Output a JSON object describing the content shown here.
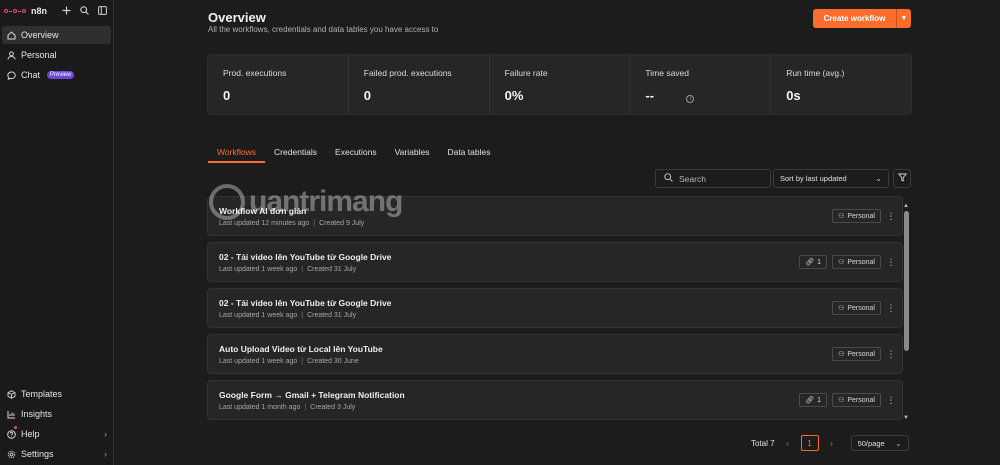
{
  "app": {
    "logo_text": "n8n",
    "brand_color": "#ea4b71",
    "accent_color": "#ff6d2d"
  },
  "sidebar": {
    "top_icons": [
      "plus-icon",
      "search-icon",
      "panel-toggle-icon"
    ],
    "items": [
      {
        "label": "Overview",
        "icon": "home-icon",
        "active": true
      },
      {
        "label": "Personal",
        "icon": "user-icon",
        "active": false
      },
      {
        "label": "Chat",
        "icon": "chat-icon",
        "active": false,
        "badge": "Preview"
      }
    ],
    "bottom_items": [
      {
        "label": "Templates",
        "icon": "box-icon"
      },
      {
        "label": "Insights",
        "icon": "chart-icon"
      },
      {
        "label": "Help",
        "icon": "help-icon"
      },
      {
        "label": "Settings",
        "icon": "gear-icon"
      }
    ]
  },
  "header": {
    "title": "Overview",
    "subtitle": "All the workflows, credentials and data tables you have access to",
    "create_label": "Create workflow"
  },
  "stats": [
    {
      "label": "Prod. executions",
      "value": "0"
    },
    {
      "label": "Failed prod. executions",
      "value": "0"
    },
    {
      "label": "Failure rate",
      "value": "0%"
    },
    {
      "label": "Time saved",
      "value": "--"
    },
    {
      "label": "Run time (avg.)",
      "value": "0s"
    }
  ],
  "tabs": [
    "Workflows",
    "Credentials",
    "Executions",
    "Variables",
    "Data tables"
  ],
  "toolbar": {
    "search_placeholder": "Search",
    "sort_label": "Sort by last updated"
  },
  "workflows": [
    {
      "name": "Workflow AI đơn giản",
      "updated": "Last updated 12 minutes ago",
      "created": "Created 9 July",
      "shared": "",
      "owner": "Personal"
    },
    {
      "name": "02 - Tải video lên YouTube từ Google Drive",
      "updated": "Last updated 1 week ago",
      "created": "Created 31 July",
      "shared": "1",
      "owner": "Personal"
    },
    {
      "name": "02 - Tải video lên YouTube từ Google Drive",
      "updated": "Last updated 1 week ago",
      "created": "Created 31 July",
      "shared": "",
      "owner": "Personal"
    },
    {
      "name": "Auto Upload Video từ Local lên YouTube",
      "updated": "Last updated 1 week ago",
      "created": "Created 30 June",
      "shared": "",
      "owner": "Personal"
    },
    {
      "name": "Google Form → Gmail + Telegram Notification",
      "updated": "Last updated 1 month ago",
      "created": "Created 3 July",
      "shared": "1",
      "owner": "Personal"
    }
  ],
  "pagination": {
    "total": "Total 7",
    "page": "1",
    "per_page": "50/page"
  },
  "watermark": {
    "text": "uantrimang"
  }
}
